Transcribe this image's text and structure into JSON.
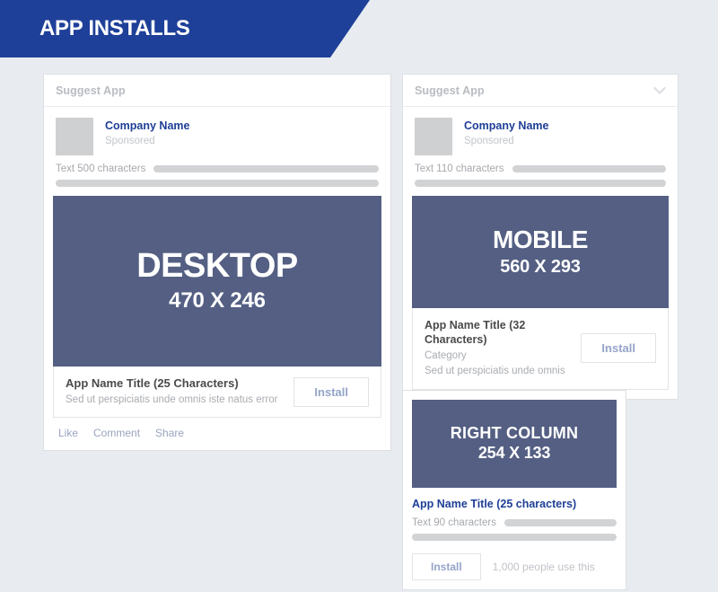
{
  "header": {
    "title": "APP INSTALLS",
    "banner_color": "#1f4099"
  },
  "colors": {
    "page_background": "#e8ecf0",
    "creative_placeholder": "#545f83",
    "brand_blue": "#1f3f96",
    "install_text": "#94a3c8",
    "placeholder_bar": "#d2d3d5",
    "avatar": "#cfd0d2"
  },
  "desktop_card": {
    "header_label": "Suggest App",
    "company_name": "Company Name",
    "sponsored_label": "Sponsored",
    "text_row_label": "Text 500 characters",
    "creative": {
      "title": "DESKTOP",
      "dimensions": "470 X 246"
    },
    "attachment": {
      "title": "App Name Title (25 Characters)",
      "subtitle": "Sed ut perspiciatis unde omnis iste natus error",
      "install_label": "Install"
    },
    "actions": [
      "Like",
      "Comment",
      "Share"
    ]
  },
  "mobile_card": {
    "header_label": "Suggest App",
    "chevron_icon": "chevron-down-icon",
    "company_name": "Company Name",
    "sponsored_label": "Sponsored",
    "text_row_label": "Text 110 characters",
    "creative": {
      "title": "MOBILE",
      "dimensions": "560 X 293"
    },
    "attachment": {
      "title": "App Name Title (32 Characters)",
      "category": "Category",
      "subtitle": "Sed ut perspiciatis unde omnis",
      "install_label": "Install"
    }
  },
  "right_column_card": {
    "creative": {
      "title": "RIGHT COLUMN",
      "dimensions": "254 X 133"
    },
    "title": "App Name Title (25 characters)",
    "text_row_label": "Text 90 characters",
    "install_label": "Install",
    "social_proof": "1,000 people use this"
  }
}
